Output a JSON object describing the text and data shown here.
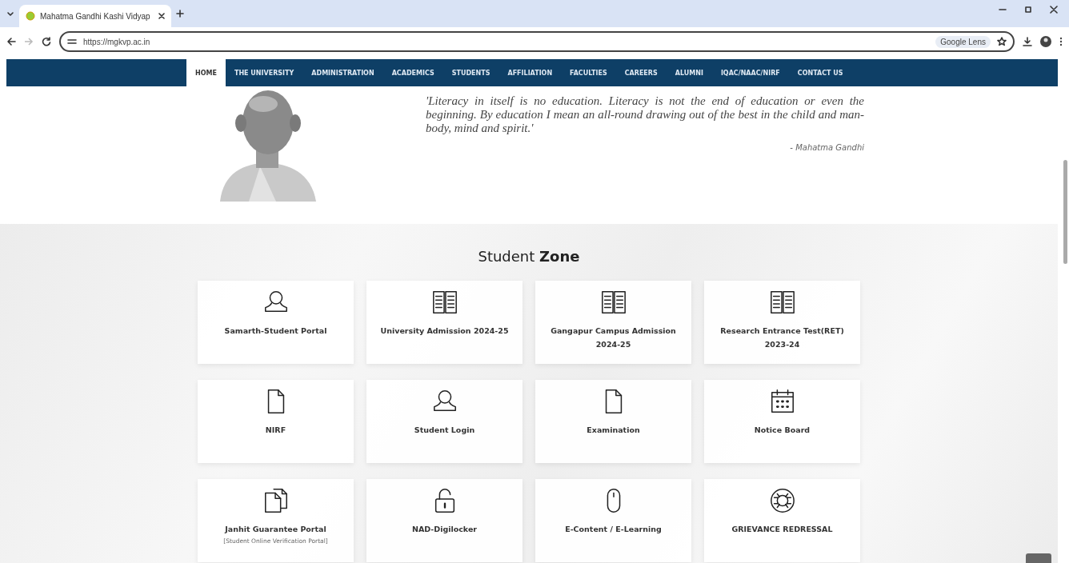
{
  "browser": {
    "tab_title": "Mahatma Gandhi Kashi Vidyap",
    "url": "https://mgkvp.ac.in",
    "lens_label": "Google Lens"
  },
  "nav": [
    {
      "label": "HOME",
      "selected": true
    },
    {
      "label": "THE UNIVERSITY",
      "selected": false
    },
    {
      "label": "ADMINISTRATION",
      "selected": false
    },
    {
      "label": "ACADEMICS",
      "selected": false
    },
    {
      "label": "STUDENTS",
      "selected": false
    },
    {
      "label": "AFFILIATION",
      "selected": false
    },
    {
      "label": "FACULTIES",
      "selected": false
    },
    {
      "label": "CAREERS",
      "selected": false
    },
    {
      "label": "ALUMNI",
      "selected": false
    },
    {
      "label": "IQAC/NAAC/NIRF",
      "selected": false
    },
    {
      "label": "CONTACT US",
      "selected": false
    }
  ],
  "quote": {
    "kind": "picture",
    "text": "'Literacy in itself is no education. Literacy is not the end of education or even the beginning. By education I mean an all-round drawing out of the best in the child and man-body, mind and spirit.'",
    "author": "- Mahatma Gandhi"
  },
  "student_zone": {
    "title": "Student **Zone**",
    "tiles": [
      {
        "kind": "user",
        "label": "Samarth-Student Portal"
      },
      {
        "kind": "book",
        "label": "University Admission 2024-25"
      },
      {
        "kind": "book",
        "label": "Gangapur Campus Admission 2024-25"
      },
      {
        "kind": "book",
        "label": "Research Entrance Test(RET) 2023-24"
      },
      {
        "kind": "file",
        "label": "NIRF"
      },
      {
        "kind": "user",
        "label": "Student Login"
      },
      {
        "kind": "file",
        "label": "Examination"
      },
      {
        "kind": "calendar",
        "label": "Notice Board"
      },
      {
        "kind": "files",
        "label": "Janhit Guarantee Portal",
        "sublabel": "[Student Online Verification Portal]"
      },
      {
        "kind": "lock",
        "label": "NAD-Digilocker"
      },
      {
        "kind": "mouse",
        "label": "E-Content / E-Learning"
      },
      {
        "kind": "lifebuoy",
        "label": "GRIEVANCE REDRESSAL"
      }
    ]
  }
}
